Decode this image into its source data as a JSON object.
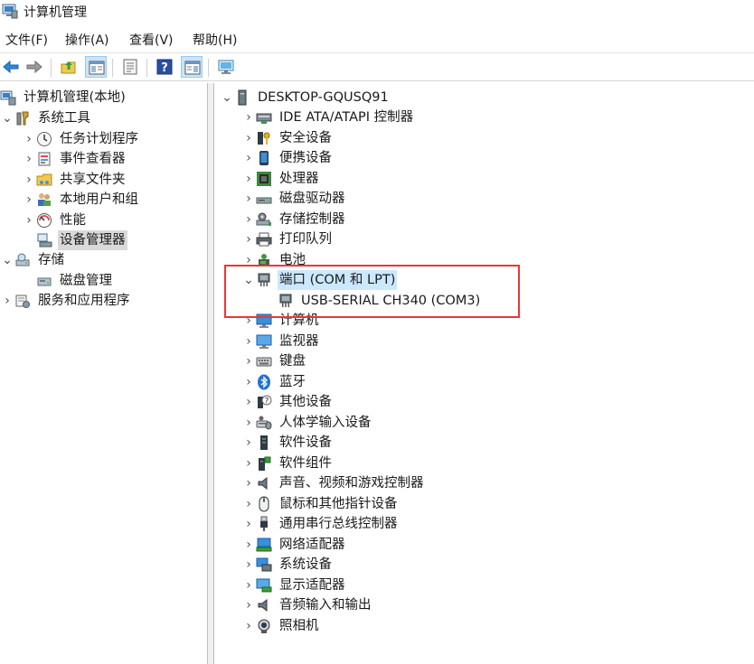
{
  "window": {
    "title": "计算机管理"
  },
  "menu": [
    {
      "label": "文件(F)"
    },
    {
      "label": "操作(A)"
    },
    {
      "label": "查看(V)"
    },
    {
      "label": "帮助(H)"
    }
  ],
  "toolbar": {
    "icons": [
      "back-arrow-icon",
      "forward-arrow-icon",
      "up-folder-icon",
      "show-hide-tree-icon",
      "properties-icon",
      "help-icon",
      "action-pane-icon",
      "monitor-icon"
    ]
  },
  "left_tree": [
    {
      "label": "计算机管理(本地)"
    },
    {
      "label": "系统工具"
    },
    {
      "label": "任务计划程序"
    },
    {
      "label": "事件查看器"
    },
    {
      "label": "共享文件夹"
    },
    {
      "label": "本地用户和组"
    },
    {
      "label": "性能"
    },
    {
      "label": "设备管理器"
    },
    {
      "label": "存储"
    },
    {
      "label": "磁盘管理"
    },
    {
      "label": "服务和应用程序"
    }
  ],
  "right_tree": {
    "root": "DESKTOP-GQUSQ91",
    "categories": [
      {
        "label": "IDE ATA/ATAPI 控制器"
      },
      {
        "label": "安全设备"
      },
      {
        "label": "便携设备"
      },
      {
        "label": "处理器"
      },
      {
        "label": "磁盘驱动器"
      },
      {
        "label": "存储控制器"
      },
      {
        "label": "打印队列"
      },
      {
        "label": "电池"
      },
      {
        "label": "端口 (COM 和 LPT)"
      },
      {
        "label": "USB-SERIAL CH340 (COM3)"
      },
      {
        "label": "计算机"
      },
      {
        "label": "监视器"
      },
      {
        "label": "键盘"
      },
      {
        "label": "蓝牙"
      },
      {
        "label": "其他设备"
      },
      {
        "label": "人体学输入设备"
      },
      {
        "label": "软件设备"
      },
      {
        "label": "软件组件"
      },
      {
        "label": "声音、视频和游戏控制器"
      },
      {
        "label": "鼠标和其他指针设备"
      },
      {
        "label": "通用串行总线控制器"
      },
      {
        "label": "网络适配器"
      },
      {
        "label": "系统设备"
      },
      {
        "label": "显示适配器"
      },
      {
        "label": "音频输入和输出"
      },
      {
        "label": "照相机"
      }
    ]
  },
  "colors": {
    "accent": "#cce8ff",
    "annotation": "#e53935"
  }
}
